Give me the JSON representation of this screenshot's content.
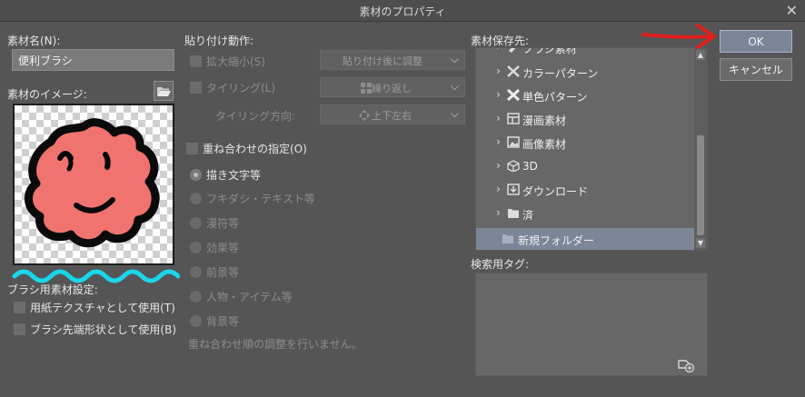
{
  "window": {
    "title": "素材のプロパティ",
    "close_glyph": "✕"
  },
  "left": {
    "name_label": "素材名(N):",
    "name_value": "便利ブラシ",
    "image_label": "素材のイメージ:",
    "folder_icon": "folder-open-icon",
    "brush_label": "ブラシ用素材設定:",
    "paper_texture": "用紙テクスチャとして使用(T)",
    "brush_tip": "ブラシ先端形状として使用(B)"
  },
  "paste": {
    "label": "貼り付け動作:",
    "scale": "拡大縮小(S)",
    "scale_dropdown": "貼り付け後に調整",
    "tiling": "タイリング(L)",
    "tiling_dropdown": "繰り返し",
    "tiling_dir_label": "タイリング方向:",
    "tiling_dir_dropdown": "上下左右",
    "overlay": "重ね合わせの指定(O)",
    "layers": [
      "描き文字等",
      "フキダシ・テキスト等",
      "漫符等",
      "効果等",
      "前景等",
      "人物・アイテム等",
      "背景等"
    ],
    "note": "重ね合わせ順の調整を行いません。"
  },
  "storage": {
    "label": "素材保存先:",
    "items": [
      {
        "label": "ブラシ素材",
        "icon": "brush-icon"
      },
      {
        "label": "カラーパターン",
        "icon": "pattern-icon"
      },
      {
        "label": "単色パターン",
        "icon": "pattern-icon"
      },
      {
        "label": "漫画素材",
        "icon": "manga-icon"
      },
      {
        "label": "画像素材",
        "icon": "image-icon"
      },
      {
        "label": "3D",
        "icon": "cube-icon"
      },
      {
        "label": "ダウンロード",
        "icon": "download-icon"
      },
      {
        "label": "済",
        "icon": "folder-icon"
      },
      {
        "label": "新規フォルダー",
        "icon": "folder-icon"
      }
    ]
  },
  "tags": {
    "label": "検索用タグ:",
    "add_icon": "tag-add-icon"
  },
  "buttons": {
    "ok": "OK",
    "cancel": "キャンセル"
  },
  "colors": {
    "selection": "#7c8699",
    "annotation_arrow": "#e0201c",
    "annotation_wave": "#19d7ea",
    "brush_fill": "#f0736f"
  }
}
